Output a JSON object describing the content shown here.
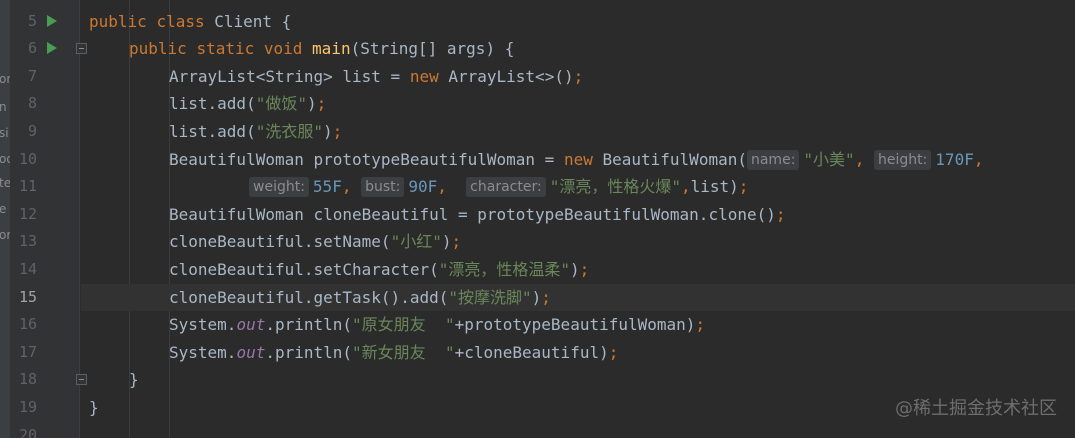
{
  "edge_fragments": [
    "or",
    "n",
    "si",
    "oo",
    "te",
    "e",
    "or"
  ],
  "lines": [
    {
      "n": "5",
      "run": true,
      "fold": false,
      "current": false,
      "indent": 0,
      "tokens": [
        {
          "t": "public ",
          "c": "kw"
        },
        {
          "t": "class ",
          "c": "kw"
        },
        {
          "t": "Client {",
          "c": ""
        }
      ]
    },
    {
      "n": "6",
      "run": true,
      "fold": true,
      "current": false,
      "indent": 1,
      "tokens": [
        {
          "t": "public ",
          "c": "kw"
        },
        {
          "t": "static ",
          "c": "kw"
        },
        {
          "t": "void ",
          "c": "kw"
        },
        {
          "t": "main",
          "c": "fn"
        },
        {
          "t": "(String[] args) {",
          "c": ""
        }
      ]
    },
    {
      "n": "7",
      "run": false,
      "fold": false,
      "current": false,
      "indent": 2,
      "tokens": [
        {
          "t": "ArrayList<String> list = ",
          "c": ""
        },
        {
          "t": "new ",
          "c": "kw"
        },
        {
          "t": "ArrayList<>()",
          "c": ""
        },
        {
          "t": ";",
          "c": "kw"
        }
      ]
    },
    {
      "n": "8",
      "run": false,
      "fold": false,
      "current": false,
      "indent": 2,
      "tokens": [
        {
          "t": "list.add(",
          "c": ""
        },
        {
          "t": "\"做饭\"",
          "c": "str"
        },
        {
          "t": ")",
          "c": ""
        },
        {
          "t": ";",
          "c": "kw"
        }
      ]
    },
    {
      "n": "9",
      "run": false,
      "fold": false,
      "current": false,
      "indent": 2,
      "tokens": [
        {
          "t": "list.add(",
          "c": ""
        },
        {
          "t": "\"洗衣服\"",
          "c": "str"
        },
        {
          "t": ")",
          "c": ""
        },
        {
          "t": ";",
          "c": "kw"
        }
      ]
    },
    {
      "n": "10",
      "run": false,
      "fold": false,
      "current": false,
      "indent": 2,
      "tokens": [
        {
          "t": "BeautifulWoman prototypeBeautifulWoman = ",
          "c": ""
        },
        {
          "t": "new ",
          "c": "kw"
        },
        {
          "t": "BeautifulWoman(",
          "c": ""
        },
        {
          "t": "name:",
          "c": "hint"
        },
        {
          "t": "\"小美\"",
          "c": "str"
        },
        {
          "t": ", ",
          "c": "kw"
        },
        {
          "t": "height:",
          "c": "hint"
        },
        {
          "t": "170F",
          "c": "num"
        },
        {
          "t": ",",
          "c": "kw"
        }
      ]
    },
    {
      "n": "11",
      "run": false,
      "fold": false,
      "current": false,
      "indent": 4,
      "tokens": [
        {
          "t": "weight:",
          "c": "hint"
        },
        {
          "t": "55F",
          "c": "num"
        },
        {
          "t": ", ",
          "c": "kw"
        },
        {
          "t": "bust:",
          "c": "hint"
        },
        {
          "t": "90F",
          "c": "num"
        },
        {
          "t": ",  ",
          "c": "kw"
        },
        {
          "t": "character:",
          "c": "hint"
        },
        {
          "t": "\"漂亮，性格火爆\"",
          "c": "str"
        },
        {
          "t": ",",
          "c": "kw"
        },
        {
          "t": "list)",
          "c": ""
        },
        {
          "t": ";",
          "c": "kw"
        }
      ]
    },
    {
      "n": "12",
      "run": false,
      "fold": false,
      "current": false,
      "indent": 2,
      "tokens": [
        {
          "t": "BeautifulWoman cloneBeautiful = prototypeBeautifulWoman.clone()",
          "c": ""
        },
        {
          "t": ";",
          "c": "kw"
        }
      ]
    },
    {
      "n": "13",
      "run": false,
      "fold": false,
      "current": false,
      "indent": 2,
      "tokens": [
        {
          "t": "cloneBeautiful.setName(",
          "c": ""
        },
        {
          "t": "\"小红\"",
          "c": "str"
        },
        {
          "t": ")",
          "c": ""
        },
        {
          "t": ";",
          "c": "kw"
        }
      ]
    },
    {
      "n": "14",
      "run": false,
      "fold": false,
      "current": false,
      "indent": 2,
      "tokens": [
        {
          "t": "cloneBeautiful.setCharacter(",
          "c": ""
        },
        {
          "t": "\"漂亮，性格温柔\"",
          "c": "str"
        },
        {
          "t": ")",
          "c": ""
        },
        {
          "t": ";",
          "c": "kw"
        }
      ]
    },
    {
      "n": "15",
      "run": false,
      "fold": false,
      "current": true,
      "indent": 2,
      "tokens": [
        {
          "t": "cloneBeautiful.getTask().add(",
          "c": ""
        },
        {
          "t": "\"按摩洗脚\"",
          "c": "str"
        },
        {
          "t": ")",
          "c": ""
        },
        {
          "t": ";",
          "c": "kw"
        }
      ]
    },
    {
      "n": "16",
      "run": false,
      "fold": false,
      "current": false,
      "indent": 2,
      "tokens": [
        {
          "t": "System.",
          "c": ""
        },
        {
          "t": "out",
          "c": "sfield"
        },
        {
          "t": ".println(",
          "c": ""
        },
        {
          "t": "\"原女朋友  \"",
          "c": "str"
        },
        {
          "t": "+prototypeBeautifulWoman)",
          "c": ""
        },
        {
          "t": ";",
          "c": "kw"
        }
      ]
    },
    {
      "n": "17",
      "run": false,
      "fold": false,
      "current": false,
      "indent": 2,
      "tokens": [
        {
          "t": "System.",
          "c": ""
        },
        {
          "t": "out",
          "c": "sfield"
        },
        {
          "t": ".println(",
          "c": ""
        },
        {
          "t": "\"新女朋友  \"",
          "c": "str"
        },
        {
          "t": "+cloneBeautiful)",
          "c": ""
        },
        {
          "t": ";",
          "c": "kw"
        }
      ]
    },
    {
      "n": "18",
      "run": false,
      "fold": true,
      "current": false,
      "indent": 1,
      "tokens": [
        {
          "t": "}",
          "c": ""
        }
      ]
    },
    {
      "n": "19",
      "run": false,
      "fold": false,
      "current": false,
      "indent": 0,
      "tokens": [
        {
          "t": "}",
          "c": ""
        }
      ]
    },
    {
      "n": "20",
      "run": false,
      "fold": false,
      "current": false,
      "indent": 0,
      "tokens": []
    }
  ],
  "watermark": "@稀土掘金技术社区"
}
